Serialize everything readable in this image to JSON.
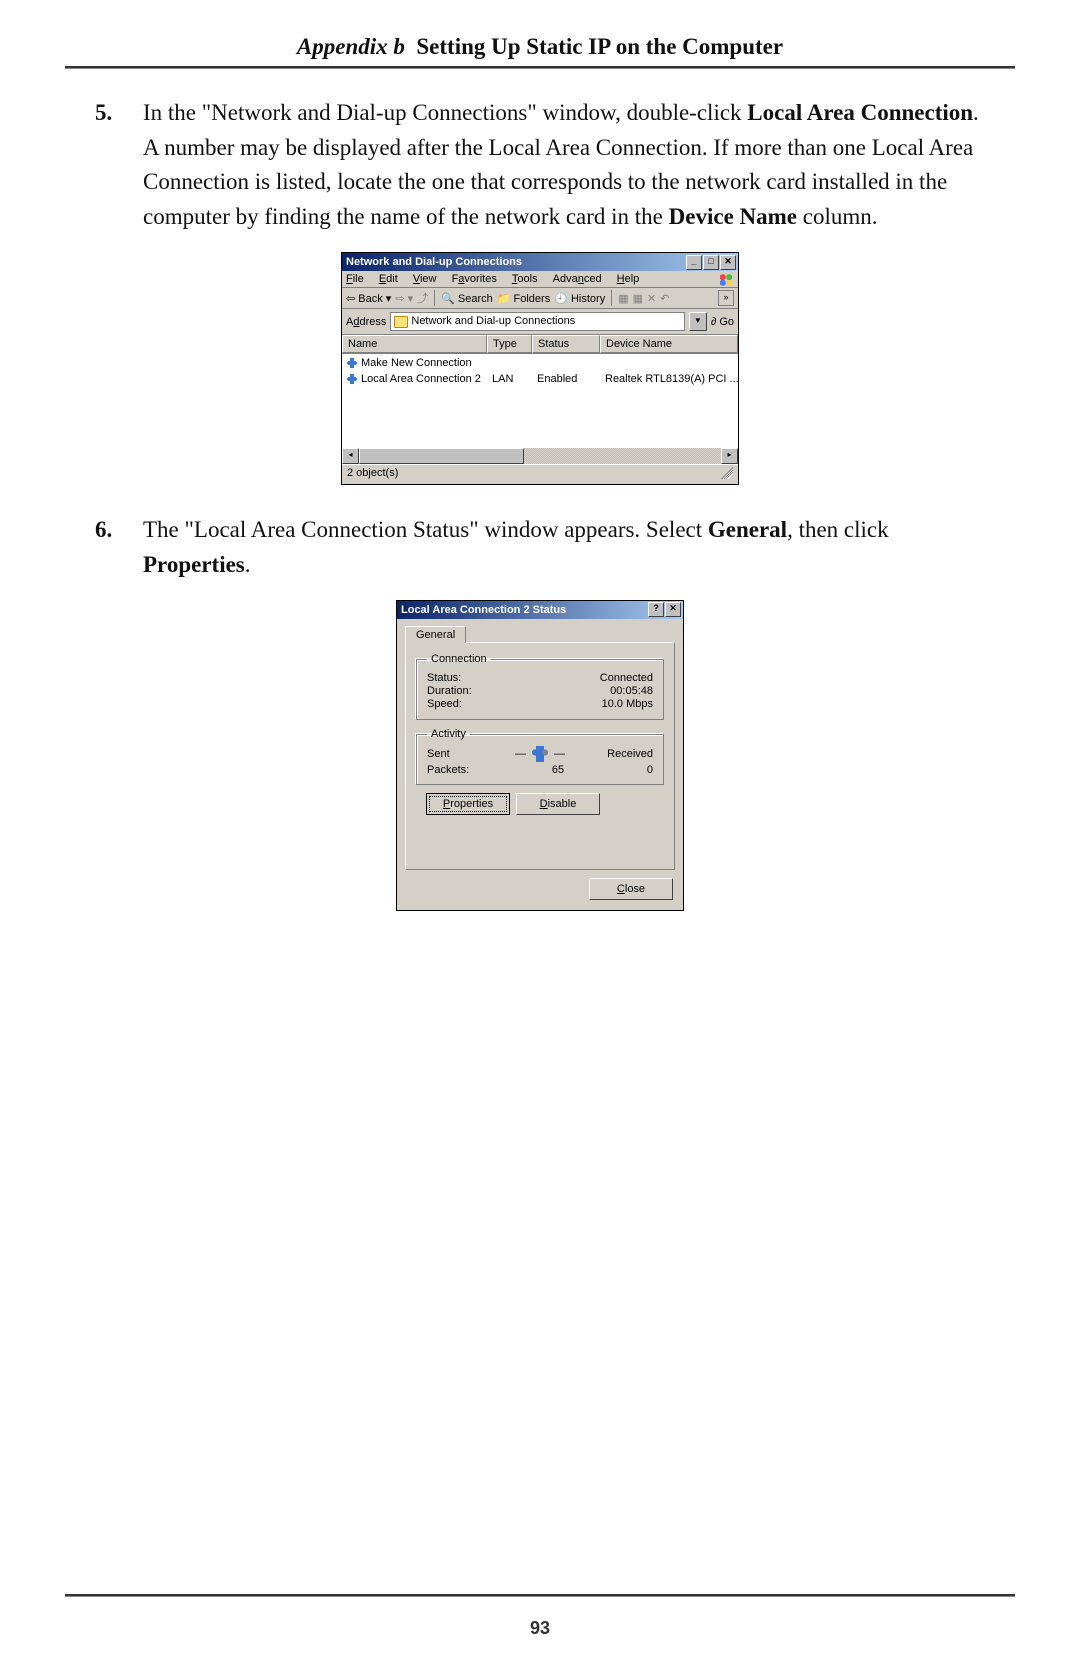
{
  "page": {
    "header_prefix": "Appendix b",
    "header_title": "Setting Up Static IP on the Computer",
    "number": "93"
  },
  "steps": {
    "s5": {
      "num": "5.",
      "pre1": "In the \"Network and Dial-up Connections\" window, double-click ",
      "b1": "Local Area Connection",
      "post1": ". A number may be displayed after the Local Area Connection. If more than one Local Area Connection is listed, locate the one that corresponds to the network card installed in the computer by finding the name of the network card in the ",
      "b2": "Device Name",
      "post2": " column."
    },
    "s6": {
      "num": "6.",
      "pre1": "The \"Local Area Connection Status\" window appears. Select ",
      "b1": "General",
      "post1": ", then click ",
      "b2": "Properties",
      "post2": "."
    }
  },
  "win1": {
    "title": "Network and Dial-up Connections",
    "menus": {
      "file": "File",
      "edit": "Edit",
      "view": "View",
      "favorites": "Favorites",
      "tools": "Tools",
      "advanced": "Advanced",
      "help": "Help"
    },
    "toolbar": {
      "back": "Back",
      "search": "Search",
      "folders": "Folders",
      "history": "History"
    },
    "win_controls": {
      "min": "_",
      "max": "□",
      "close": "✕",
      "more": "»"
    },
    "address_label": "Address",
    "address_value": "Network and Dial-up Connections",
    "go": "Go",
    "cols": {
      "name": "Name",
      "type": "Type",
      "status": "Status",
      "device": "Device Name"
    },
    "rows": [
      {
        "name": "Make New Connection",
        "type": "",
        "status": "",
        "device": ""
      },
      {
        "name": "Local Area Connection 2",
        "type": "LAN",
        "status": "Enabled",
        "device": "Realtek RTL8139(A) PCI ..."
      }
    ],
    "statusbar": "2 object(s)"
  },
  "win2": {
    "title": "Local Area Connection 2 Status",
    "win_controls": {
      "help": "?",
      "close": "✕"
    },
    "tab": "General",
    "connection": {
      "legend": "Connection",
      "status_l": "Status:",
      "status_v": "Connected",
      "dur_l": "Duration:",
      "dur_v": "00:05:48",
      "speed_l": "Speed:",
      "speed_v": "10.0 Mbps"
    },
    "activity": {
      "legend": "Activity",
      "sent": "Sent",
      "recv": "Received",
      "packets_l": "Packets:",
      "sent_v": "65",
      "recv_v": "0"
    },
    "buttons": {
      "properties": "Properties",
      "disable": "Disable",
      "close": "Close"
    }
  }
}
